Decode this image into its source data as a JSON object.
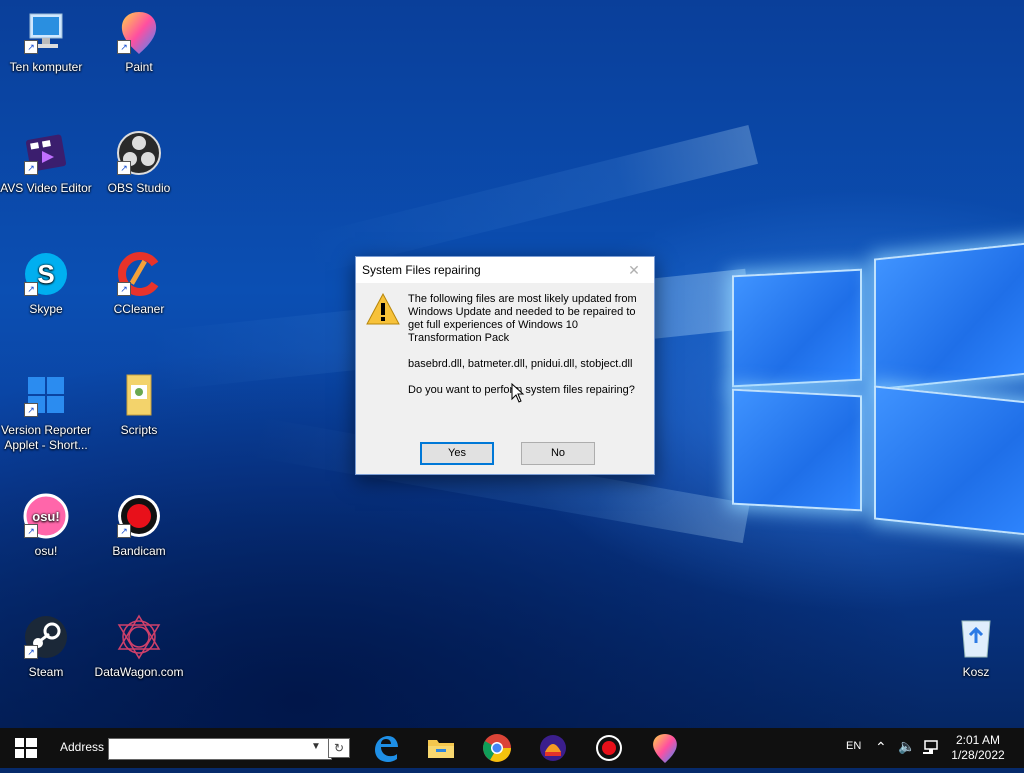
{
  "desktop": {
    "icons": [
      {
        "label": "Ten komputer"
      },
      {
        "label": "Paint"
      },
      {
        "label": "AVS Video Editor"
      },
      {
        "label": "OBS Studio"
      },
      {
        "label": "Skype"
      },
      {
        "label": "CCleaner"
      },
      {
        "label": "Version Reporter Applet - Short..."
      },
      {
        "label": "Scripts"
      },
      {
        "label": "osu!"
      },
      {
        "label": "Bandicam"
      },
      {
        "label": "Steam"
      },
      {
        "label": "DataWagon.com"
      },
      {
        "label": "Kosz"
      }
    ]
  },
  "dialog": {
    "title": "System Files repairing",
    "close_glyph": "✕",
    "message_1": "The following files are most likely updated from Windows Update and needed to be repaired to get full experiences of Windows 10 Transformation Pack",
    "message_2": "basebrd.dll, batmeter.dll, pnidui.dll, stobject.dll",
    "message_3": "Do you want to perform system files repairing?",
    "yes_label": "Yes",
    "no_label": "No"
  },
  "taskbar": {
    "address_label": "Address",
    "address_value": "",
    "apps": [
      "edge-icon",
      "file-explorer-icon",
      "chrome-icon",
      "avs-icon",
      "bandicam-icon",
      "paint-icon"
    ],
    "language": "EN",
    "time": "2:01 AM",
    "date": "1/28/2022"
  },
  "colors": {
    "accent": "#0078d7",
    "taskbar": "#101010"
  }
}
